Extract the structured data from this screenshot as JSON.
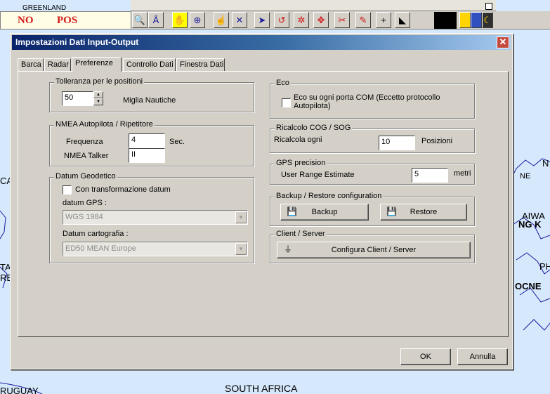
{
  "map": {
    "labels": [
      "GREENLAND",
      "RUGUAY",
      "SOUTH AFRICA",
      "CA",
      "TA",
      "RE",
      "N",
      "AIWA",
      "NG K",
      "PH",
      "OCNE",
      "NE"
    ]
  },
  "toolbar": {
    "status_left": "NO",
    "status_right": "POS",
    "tools": [
      "search-icon",
      "compass-icon",
      "pan-hand-icon",
      "crosshair-icon",
      "hand-point-icon",
      "scale-icon",
      "cursor-icon",
      "route-icon",
      "waypoint-icon",
      "move-icon",
      "scissors-icon",
      "pencil-icon",
      "plus-icon",
      "profile-icon"
    ],
    "active_tool": "pan-hand-icon",
    "tool_glyphs": [
      "🔍",
      "Å",
      "✋",
      "⊕",
      "☝",
      "✕",
      "➤",
      "↺",
      "✲",
      "✥",
      "✂",
      "✎",
      "+",
      "◣"
    ]
  },
  "dialog": {
    "title": "Impostazioni Dati Input-Output",
    "close_label": "✕",
    "tabs": [
      "Barca",
      "Radar",
      "Preferenze",
      "Controllo Dati",
      "Finestra Dati"
    ],
    "selected_tab": "Preferenze",
    "tolleranza": {
      "title": "Tolleranza per le positioni",
      "value": "50",
      "unit": "Miglia Nautiche"
    },
    "nmea": {
      "title": "NMEA Autopilota / Ripetitore",
      "freq_label": "Frequenza",
      "freq_value": "4",
      "freq_unit": "Sec.",
      "talker_label": "NMEA Talker",
      "talker_value": "II"
    },
    "datum": {
      "title": "Datum Geodetico",
      "checkbox_label": "Con transformazione datum",
      "gps_label": "datum GPS :",
      "gps_value": "WGS 1984",
      "carto_label": "Datum cartografia :",
      "carto_value": "ED50 MEAN Europe"
    },
    "eco": {
      "title": "Eco",
      "checkbox_label_1": "Eco su ogni porta COM (Eccetto protocollo",
      "checkbox_label_2": "Autopilota)"
    },
    "ricalcolo": {
      "title": "Ricalcolo COG / SOG",
      "label": "Ricalcola ogni",
      "value": "10",
      "unit": "Posizioni"
    },
    "gps": {
      "title": "GPS precision",
      "label": "User Range Estimate",
      "value": "5",
      "unit": "metri"
    },
    "backup": {
      "title": "Backup / Restore configuration",
      "backup_label": "Backup",
      "restore_label": "Restore"
    },
    "client": {
      "title": "Client / Server",
      "button_label": "Configura Client / Server"
    },
    "ok_label": "OK",
    "cancel_label": "Annulla"
  }
}
